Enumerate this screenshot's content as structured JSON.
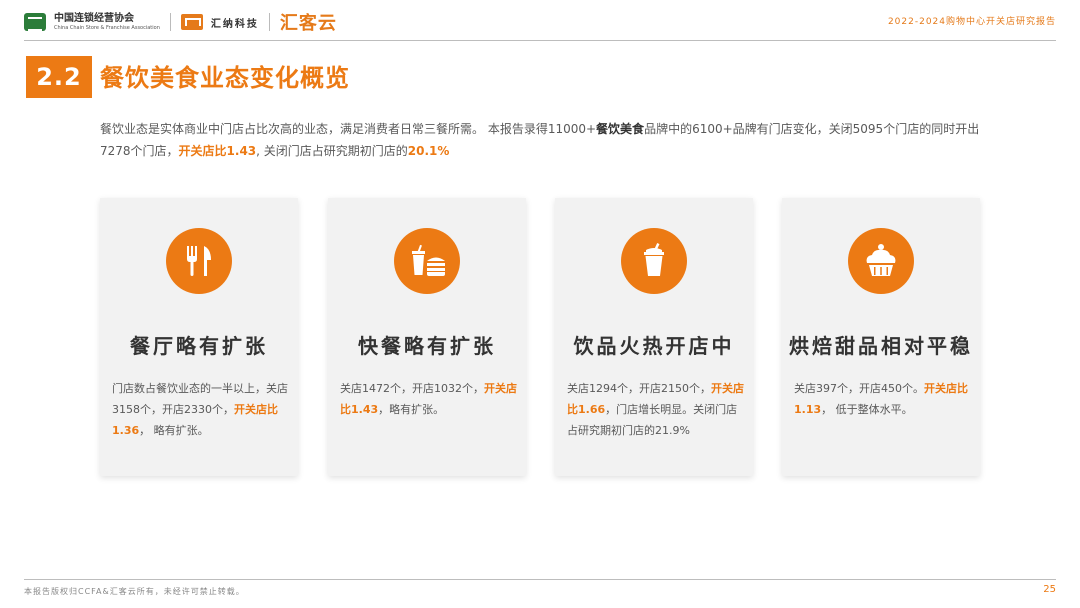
{
  "header": {
    "logo_ccfa_cn": "中国连锁经营协会",
    "logo_ccfa_en": "China Chain Store & Franchise Association",
    "logo_huina": "汇纳科技",
    "logo_huikeyun": "汇客云",
    "report_title": "2022-2024购物中心开关店研究报告"
  },
  "section": {
    "number": "2.2",
    "title": "餐饮美食业态变化概览"
  },
  "intro": {
    "p1": "餐饮业态是实体商业中门店占比次高的业态，满足消费者日常三餐所需。 本报告录得11000+",
    "p1_bold": "餐饮美食",
    "p2": "品牌中的6100+品牌有门店变化，关闭5095个门店的同时开出7278个门店，",
    "p2_hl1": "开关店比1.43",
    "p3": ", 关闭门店占研究期初门店的",
    "p3_hl2": "20.1%"
  },
  "cards": [
    {
      "icon": "fork-knife-icon",
      "title": "餐厅略有扩张",
      "d1": "门店数占餐饮业态的一半以上，关店3158个，开店2330个，",
      "hl": "开关店比1.36",
      "d2": "，   略有扩张。"
    },
    {
      "icon": "fast-food-icon",
      "title": "快餐略有扩张",
      "d1": "关店1472个，开店1032个，",
      "hl": "开关店比1.43",
      "d2": "，略有扩张。"
    },
    {
      "icon": "drink-cup-icon",
      "title": "饮品火热开店中",
      "d1": "关店1294个，开店2150个，",
      "hl": "开关店比1.66",
      "d2": "，门店增长明显。关闭门店占研究期初门店的21.9%"
    },
    {
      "icon": "cupcake-icon",
      "title": "烘焙甜品相对平稳",
      "d1": "关店397个，开店450个。",
      "hl": "开关店比1.13",
      "d2": "，  低于整体水平。"
    }
  ],
  "footer": {
    "copyright": "本报告版权归CCFA&汇客云所有，未经许可禁止转载。",
    "page": "25"
  },
  "colors": {
    "accent": "#ec7a14",
    "card_bg": "#f2f2f2"
  }
}
